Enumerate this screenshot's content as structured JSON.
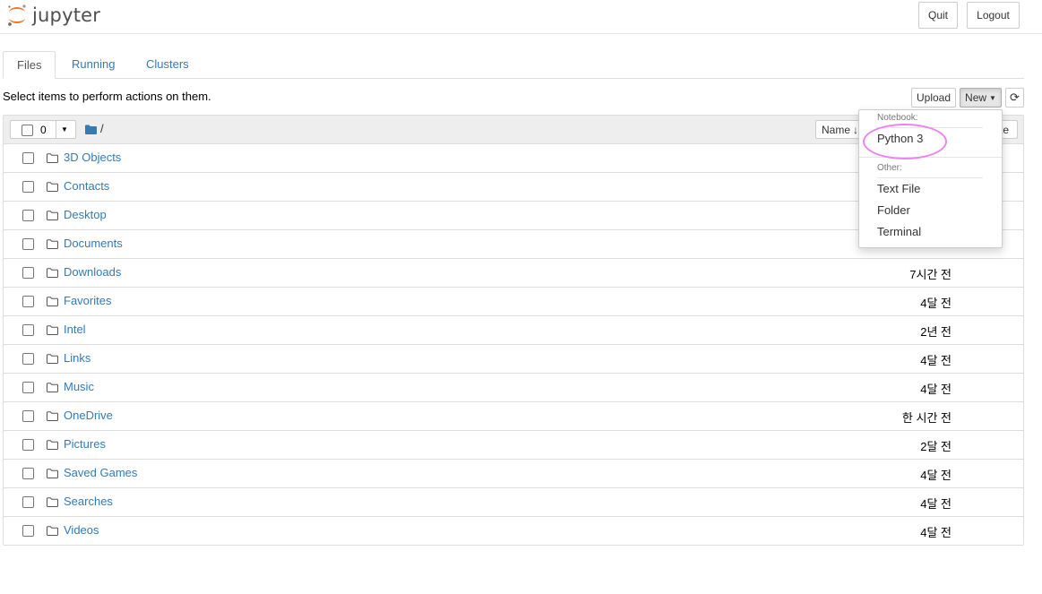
{
  "app": {
    "logo_text": "jupyter"
  },
  "header": {
    "quit_label": "Quit",
    "logout_label": "Logout"
  },
  "tabs": [
    {
      "label": "Files"
    },
    {
      "label": "Running"
    },
    {
      "label": "Clusters"
    }
  ],
  "toolbar": {
    "hint": "Select items to perform actions on them.",
    "upload_label": "Upload",
    "new_label": "New",
    "select_count": "0",
    "breadcrumb": "/",
    "sort_name_label": "Name",
    "sort_modified_label": "te"
  },
  "new_menu": {
    "notebook_header": "Notebook:",
    "python_label": "Python 3",
    "other_header": "Other:",
    "text_file_label": "Text File",
    "folder_label": "Folder",
    "terminal_label": "Terminal"
  },
  "items": [
    {
      "name": "3D Objects",
      "modified": ""
    },
    {
      "name": "Contacts",
      "modified": ""
    },
    {
      "name": "Desktop",
      "modified": ""
    },
    {
      "name": "Documents",
      "modified": ""
    },
    {
      "name": "Downloads",
      "modified": "7시간 전"
    },
    {
      "name": "Favorites",
      "modified": "4달 전"
    },
    {
      "name": "Intel",
      "modified": "2년 전"
    },
    {
      "name": "Links",
      "modified": "4달 전"
    },
    {
      "name": "Music",
      "modified": "4달 전"
    },
    {
      "name": "OneDrive",
      "modified": "한 시간 전"
    },
    {
      "name": "Pictures",
      "modified": "2달 전"
    },
    {
      "name": "Saved Games",
      "modified": "4달 전"
    },
    {
      "name": "Searches",
      "modified": "4달 전"
    },
    {
      "name": "Videos",
      "modified": "4달 전"
    }
  ],
  "colors": {
    "link": "#337ab7",
    "logo_orange": "#f37626",
    "highlight": "#ee82ee"
  }
}
